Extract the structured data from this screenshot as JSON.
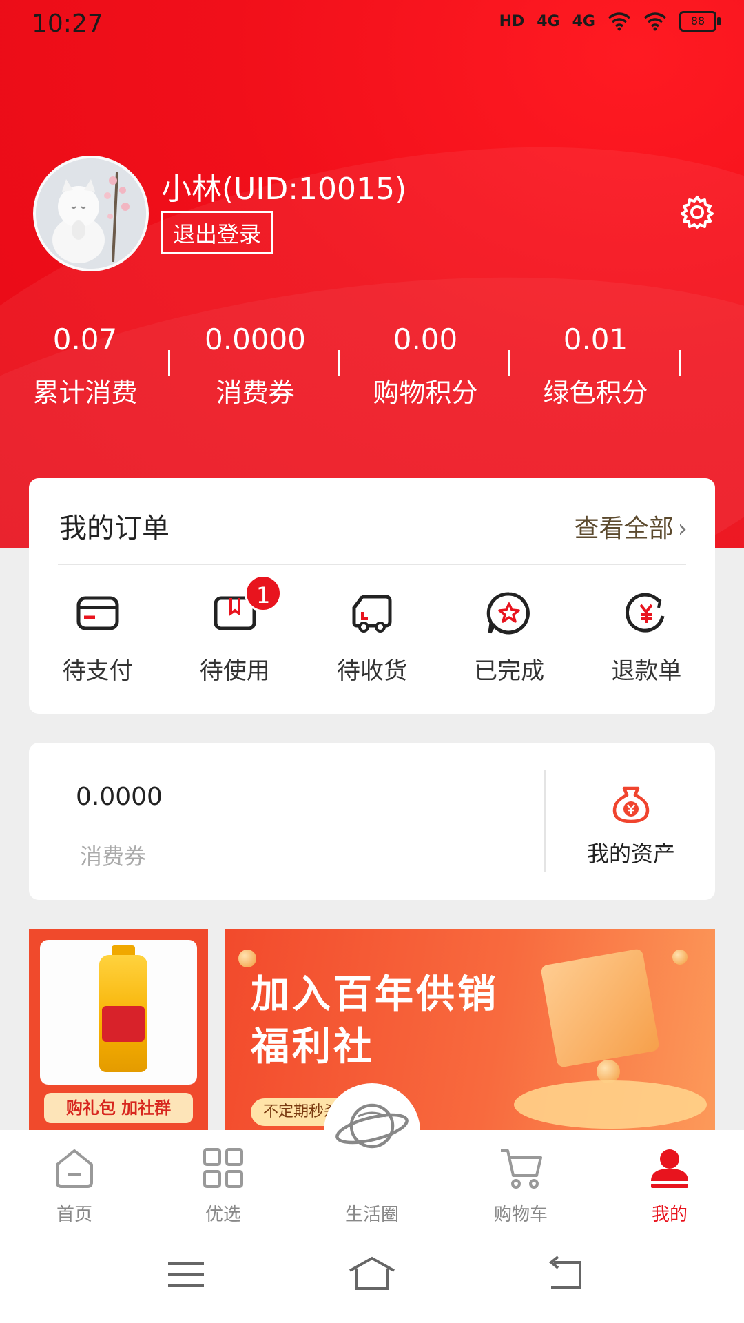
{
  "status_bar": {
    "time": "10:27",
    "hd": "HD",
    "net1": "4G",
    "net2": "4G",
    "battery": "88"
  },
  "profile": {
    "username": "小林(UID:10015)",
    "logout_label": "退出登录"
  },
  "stats": [
    {
      "value": "0.07",
      "label": "累计消费"
    },
    {
      "value": "0.0000",
      "label": "消费券"
    },
    {
      "value": "0.00",
      "label": "购物积分"
    },
    {
      "value": "0.01",
      "label": "绿色积分"
    }
  ],
  "orders": {
    "title": "我的订单",
    "view_all": "查看全部",
    "items": [
      {
        "label": "待支付",
        "icon": "card-icon"
      },
      {
        "label": "待使用",
        "icon": "ticket-icon",
        "badge": "1"
      },
      {
        "label": "待收货",
        "icon": "truck-icon"
      },
      {
        "label": "已完成",
        "icon": "star-chat-icon"
      },
      {
        "label": "退款单",
        "icon": "refund-icon"
      }
    ]
  },
  "assets": {
    "coupon_value": "0.0000",
    "coupon_label": "消费券",
    "my_assets_label": "我的资产"
  },
  "banners": {
    "gift_tag": "购礼包 加社群",
    "promo_title_line1": "加入百年供销",
    "promo_title_line2": "福利社",
    "promo_tag": "不定期秒杀送"
  },
  "tabbar": [
    {
      "label": "首页",
      "icon": "home-icon"
    },
    {
      "label": "优选",
      "icon": "grid-icon"
    },
    {
      "label": "生活圈",
      "icon": "planet-icon"
    },
    {
      "label": "购物车",
      "icon": "cart-icon"
    },
    {
      "label": "我的",
      "icon": "user-icon",
      "active": true
    }
  ],
  "colors": {
    "brand_red": "#e8141e",
    "hero_red": "#f10f1a",
    "gold_text": "#5c4a2e"
  }
}
